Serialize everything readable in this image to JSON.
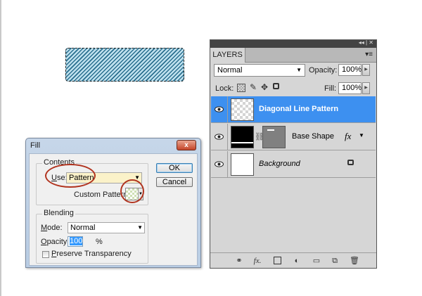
{
  "fill_dialog": {
    "title": "Fill",
    "close_glyph": "x",
    "contents_legend": "Contents",
    "use_label_key": "U",
    "use_label_rest": "se:",
    "use_value": "Pattern",
    "custom_pattern_label": "Custom Pattern:",
    "blending_legend": "Blending",
    "mode_label_key": "M",
    "mode_label_rest": "ode:",
    "mode_value": "Normal",
    "opacity_label_key": "O",
    "opacity_label_rest": "pacity:",
    "opacity_value": "100",
    "opacity_unit": "%",
    "preserve_key": "P",
    "preserve_rest": "reserve Transparency",
    "ok_label": "OK",
    "cancel_label": "Cancel"
  },
  "layers_panel": {
    "tab_label": "LAYERS",
    "top_controls": "◂◂ | ✕",
    "menu_glyph": "▾≡",
    "blend_mode": "Normal",
    "opacity_label": "Opacity:",
    "opacity_value": "100%",
    "lock_label": "Lock:",
    "fill_label": "Fill:",
    "fill_value": "100%",
    "layers": [
      {
        "name": "Diagonal Line Pattern",
        "selected": true
      },
      {
        "name": "Base Shape",
        "fx": "fx"
      },
      {
        "name": "Background",
        "locked": true
      }
    ],
    "bottom_icons": [
      "link-layers-icon",
      "fx-icon",
      "mask-icon",
      "adjustment-icon",
      "group-icon",
      "new-layer-icon",
      "trash-icon"
    ]
  },
  "colors": {
    "selection_blue": "#3d90f0",
    "annotation_red": "#b1331e",
    "pattern_teal": "#2a6f8f"
  }
}
